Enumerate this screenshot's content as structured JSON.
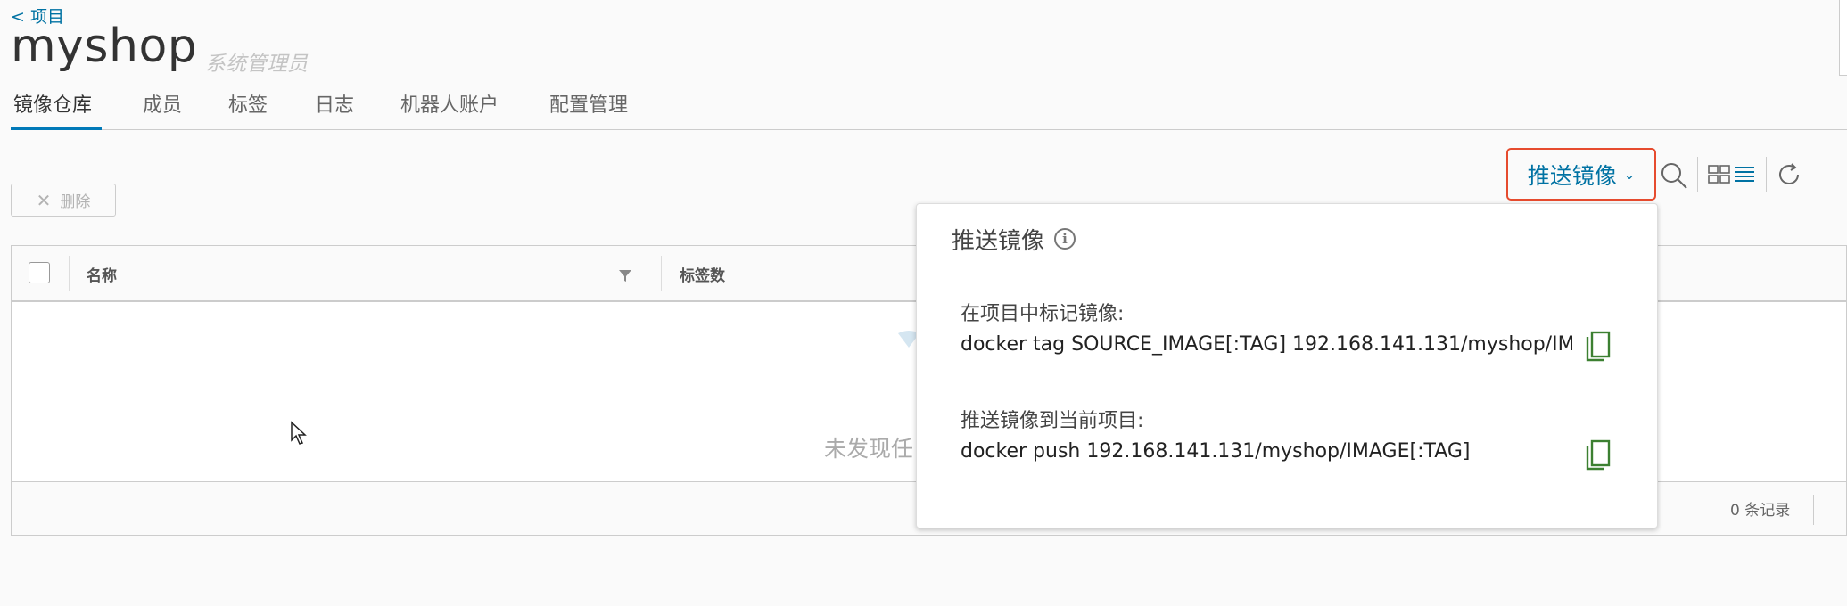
{
  "header": {
    "back_link": "< 项目",
    "project_name": "myshop",
    "role": "系统管理员"
  },
  "tabs": [
    {
      "label": "镜像仓库",
      "active": true
    },
    {
      "label": "成员"
    },
    {
      "label": "标签"
    },
    {
      "label": "日志"
    },
    {
      "label": "机器人账户"
    },
    {
      "label": "配置管理"
    }
  ],
  "toolbar": {
    "delete_label": "删除",
    "push_label": "推送镜像",
    "icons": [
      "search-icon",
      "card-view-icon",
      "list-view-icon",
      "refresh-icon"
    ]
  },
  "table": {
    "columns": [
      "名称",
      "标签数"
    ],
    "empty_text": "未发现任",
    "records": "0 条记录"
  },
  "popover": {
    "title": "推送镜像",
    "tag_label": "在项目中标记镜像:",
    "tag_command": "docker tag SOURCE_IMAGE[:TAG] 192.168.141.131/myshop/IM",
    "push_label": "推送镜像到当前项目:",
    "push_command": "docker push 192.168.141.131/myshop/IMAGE[:TAG]"
  },
  "colors": {
    "accent": "#0072a3",
    "highlight_border": "#e64b2e",
    "copy_icon": "#3c8031"
  }
}
